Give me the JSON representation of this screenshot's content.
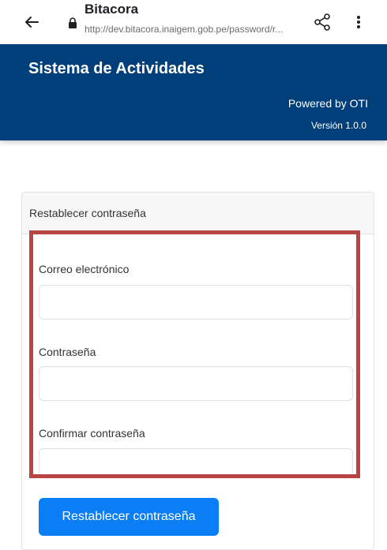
{
  "browser": {
    "title": "Bitacora",
    "url": "http://dev.bitacora.inaigem.gob.pe/password/r..."
  },
  "header": {
    "title": "Sistema de Actividades",
    "powered_by": "Powered by OTI",
    "version": "Versión 1.0.0"
  },
  "form": {
    "card_title": "Restablecer contraseña",
    "email_label": "Correo electrónico",
    "email_value": "",
    "password_label": "Contraseña",
    "password_value": "",
    "confirm_label": "Confirmar contraseña",
    "confirm_value": "",
    "submit_label": "Restablecer contraseña"
  },
  "colors": {
    "header_bg": "#013f7a",
    "button_bg": "#0a7ef5",
    "highlight_border": "#b84444"
  },
  "icons": {
    "back": "arrow-left",
    "lock": "lock",
    "share": "share",
    "menu": "more-vertical"
  }
}
